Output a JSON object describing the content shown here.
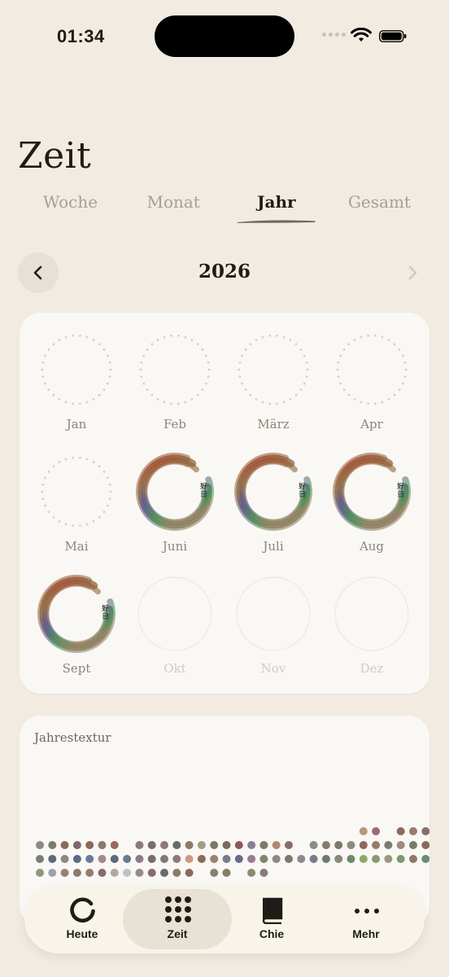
{
  "status_bar": {
    "time": "01:34"
  },
  "header": {
    "title": "Zeit"
  },
  "tabs": [
    {
      "label": "Woche",
      "active": false
    },
    {
      "label": "Monat",
      "active": false
    },
    {
      "label": "Jahr",
      "active": true
    },
    {
      "label": "Gesamt",
      "active": false
    }
  ],
  "year_nav": {
    "year": "2026",
    "prev_icon": "chevron-left-icon",
    "next_icon": "chevron-right-icon"
  },
  "months": [
    {
      "label": "Jan",
      "state": "empty"
    },
    {
      "label": "Feb",
      "state": "empty"
    },
    {
      "label": "März",
      "state": "empty"
    },
    {
      "label": "Apr",
      "state": "empty"
    },
    {
      "label": "Mai",
      "state": "empty"
    },
    {
      "label": "Juni",
      "state": "filled",
      "badge": "好日"
    },
    {
      "label": "Juli",
      "state": "filled",
      "badge": "好日"
    },
    {
      "label": "Aug",
      "state": "filled",
      "badge": "好日"
    },
    {
      "label": "Sept",
      "state": "filled",
      "badge": "好日"
    },
    {
      "label": "Okt",
      "state": "future"
    },
    {
      "label": "Nov",
      "state": "future"
    },
    {
      "label": "Dez",
      "state": "future"
    }
  ],
  "texture": {
    "title": "Jahrestextur",
    "rows": [
      [
        "",
        "",
        "",
        "",
        "",
        "",
        "",
        "",
        "",
        "",
        "",
        "",
        "",
        "",
        "",
        "",
        "",
        "",
        "",
        "",
        "",
        "",
        "",
        "",
        "",
        "",
        "#b49a7a",
        "#9e6b6e",
        "",
        "#8b6b5a",
        "#9b7b6b",
        "#8a6e6e",
        "#6a6a80",
        "#7b6a5a",
        "#7a9a6a"
      ],
      [
        "#8a8a80",
        "#7b7b6a",
        "#8a6b5a",
        "#7b6a6a",
        "#8b6a5a",
        "#8a7a6a",
        "#9a6a5a",
        "",
        "#8a7a7a",
        "#7a6a6a",
        "#8a7a7a",
        "#6a6a6a",
        "#8b7b6b",
        "#9aa080",
        "#7a7a6a",
        "#7a6a5a",
        "#8a5a5a",
        "#8a8090",
        "#7b7b6a",
        "#b08a6a",
        "#8a6b6b",
        "",
        "#8b8b8b",
        "#8a7a6a",
        "#7a7a6a",
        "#8b8b7a",
        "#8a6a5a",
        "#9a7a6a",
        "#7a7a70",
        "#a08a7a",
        "#7a7a6a",
        "#8a6a5a",
        "#6a7a6a",
        "#8a7a7a",
        "#8a5a4a"
      ],
      [
        "#7b7b7b",
        "#5a6a7a",
        "#8a8a80",
        "#5a6a8a",
        "#6a7a9a",
        "#a08a8a",
        "#5a6a7a",
        "#6a7a8a",
        "#8a7a8a",
        "#7a6a6a",
        "#7a7a7a",
        "#8a7a7a",
        "#d09a80",
        "#8a6a5a",
        "#9a8070",
        "#7b7b8b",
        "#6a6a8a",
        "#9a7a9a",
        "#7a8a6a",
        "#8a8a8a",
        "#7a7a6a",
        "#8a8a8a",
        "#7a7a8a",
        "#6a7a7a",
        "#8a8a7a",
        "#6a8a6a",
        "#8aaa6a",
        "#8a9a6a",
        "#9a9a7a",
        "#7a9a6a",
        "#8a7a6a",
        "#6a8a7a",
        "#9aaa7a",
        "#5a8a5a",
        "#7a7a9a"
      ],
      [
        "#8a9a7a",
        "#a0a0b0",
        "#9a8070",
        "#8a7a70",
        "#9a7a6a",
        "#8a6a6a",
        "#b0a8a0",
        "#c0c0c8",
        "#9a8a8a",
        "#8a6a6a",
        "#6a6a6a",
        "#8a7a6a",
        "#8a6a5a",
        "",
        "#8a8070",
        "#8a7a6a",
        "",
        "#8a8a70",
        "#8a7a7a"
      ]
    ]
  },
  "nav": [
    {
      "label": "Heute",
      "icon": "enso-icon",
      "active": false
    },
    {
      "label": "Zeit",
      "icon": "grid-icon",
      "active": true
    },
    {
      "label": "Chie",
      "icon": "book-icon",
      "active": false
    },
    {
      "label": "Mehr",
      "icon": "more-icon",
      "active": false
    }
  ]
}
